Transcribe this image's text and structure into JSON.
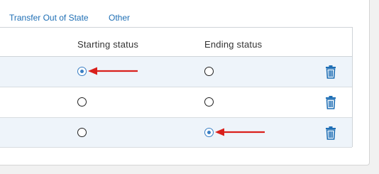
{
  "tabs": [
    {
      "label": "Transfer Out of State"
    },
    {
      "label": "Other"
    }
  ],
  "table": {
    "headers": {
      "starting_status": "Starting status",
      "ending_status": "Ending status"
    },
    "rows": [
      {
        "starting_selected": true,
        "ending_selected": false,
        "annotation": "arrow-pointing-to-starting-status"
      },
      {
        "starting_selected": false,
        "ending_selected": false
      },
      {
        "starting_selected": false,
        "ending_selected": true,
        "annotation": "arrow-pointing-to-ending-status"
      }
    ]
  },
  "colors": {
    "link": "#1f6fb5",
    "selected_radio": "#3a7fc4",
    "annotation_arrow": "#d9201c",
    "trash_icon": "#1f6fb5",
    "row_highlight": "#eef4fa"
  },
  "icons": {
    "delete": "trash-icon",
    "annotation": "red-arrow-icon"
  }
}
